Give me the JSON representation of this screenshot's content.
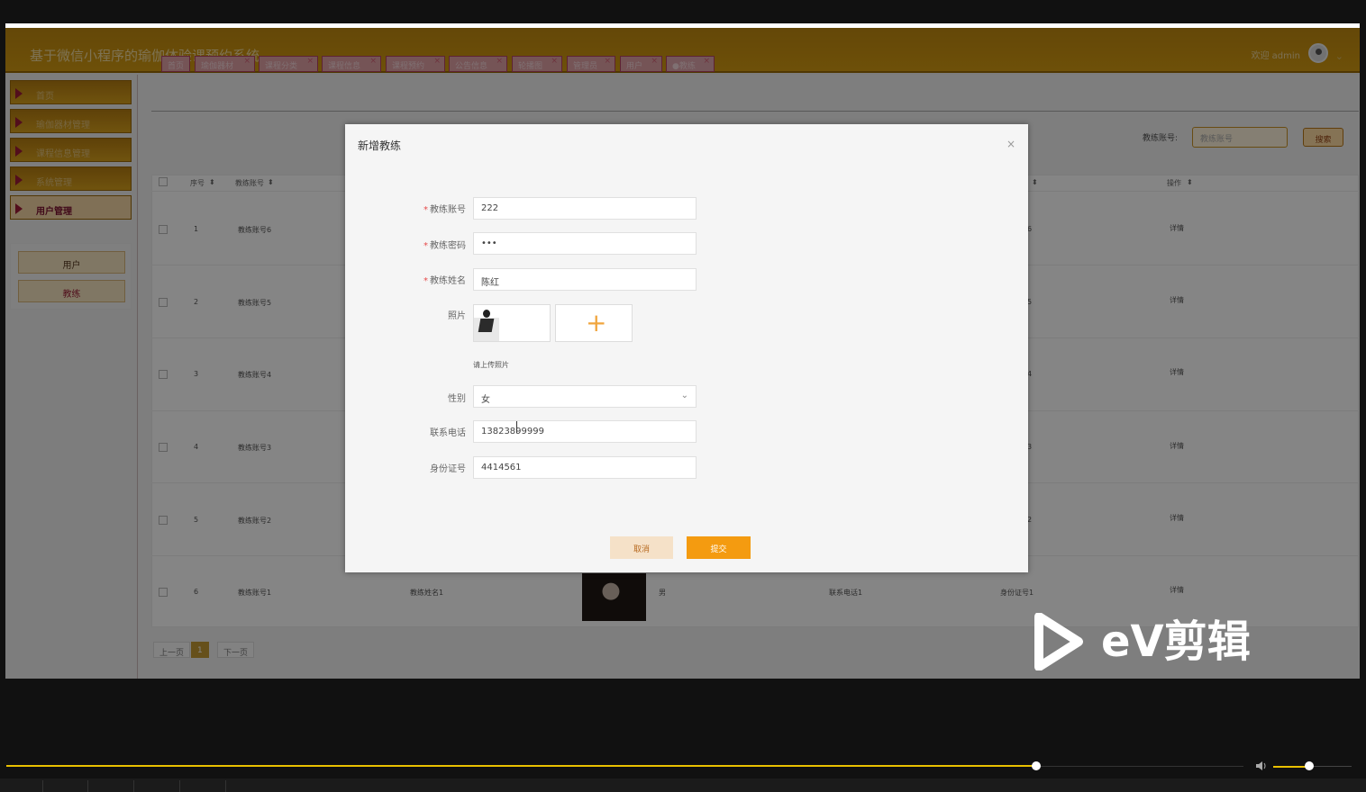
{
  "app": {
    "title": "基于微信小程序的瑜伽体验课预约系统",
    "welcome": "欢迎 admin"
  },
  "sidebar": {
    "items": [
      {
        "label": "首页"
      },
      {
        "label": "瑜伽器材管理"
      },
      {
        "label": "课程信息管理"
      },
      {
        "label": "系统管理"
      },
      {
        "label": "用户管理"
      }
    ],
    "sub_items": [
      {
        "label": "用户"
      },
      {
        "label": "教练"
      }
    ]
  },
  "tabs": [
    {
      "label": "首页"
    },
    {
      "label": "瑜伽器材"
    },
    {
      "label": "课程分类"
    },
    {
      "label": "课程信息"
    },
    {
      "label": "课程预约"
    },
    {
      "label": "公告信息"
    },
    {
      "label": "轮播图"
    },
    {
      "label": "管理员"
    },
    {
      "label": "用户"
    },
    {
      "label": "●教练"
    }
  ],
  "search": {
    "label": "教练账号:",
    "placeholder": "教练账号",
    "button": "搜索"
  },
  "table": {
    "headers": [
      "序号",
      "教练账号",
      "操作"
    ],
    "rows": [
      {
        "no": "1",
        "account": "教练账号6",
        "id": "6",
        "action": "详情"
      },
      {
        "no": "2",
        "account": "教练账号5",
        "id": "5",
        "action": "详情"
      },
      {
        "no": "3",
        "account": "教练账号4",
        "id": "4",
        "action": "详情"
      },
      {
        "no": "4",
        "account": "教练账号3",
        "id": "3",
        "action": "详情"
      },
      {
        "no": "5",
        "account": "教练账号2",
        "id": "2",
        "action": "详情"
      },
      {
        "no": "6",
        "account": "教练账号1",
        "name": "教练姓名1",
        "gender": "男",
        "phone": "联系电话1",
        "id": "身份证号1",
        "action": "详情"
      }
    ]
  },
  "pager": {
    "prev": "上一页",
    "page": "1",
    "next": "下一页"
  },
  "modal": {
    "title": "新增教练",
    "close": "×",
    "fields": {
      "account_label": "教练账号",
      "account_value": "222",
      "password_label": "教练密码",
      "password_value": "•••",
      "name_label": "教练姓名",
      "name_value": "陈红",
      "photo_label": "照片",
      "photo_hint": "请上传照片",
      "gender_label": "性别",
      "gender_value": "女",
      "phone_label": "联系电话",
      "phone_value": "13823899999",
      "idcard_label": "身份证号",
      "idcard_value": "4414561"
    },
    "buttons": {
      "cancel": "取消",
      "submit": "提交"
    }
  },
  "watermark": {
    "text": "eV剪辑"
  },
  "colors": {
    "header": "#c08a10",
    "accent": "#f49b10",
    "danger": "#e64b4b",
    "timeline": "#e9c000"
  }
}
